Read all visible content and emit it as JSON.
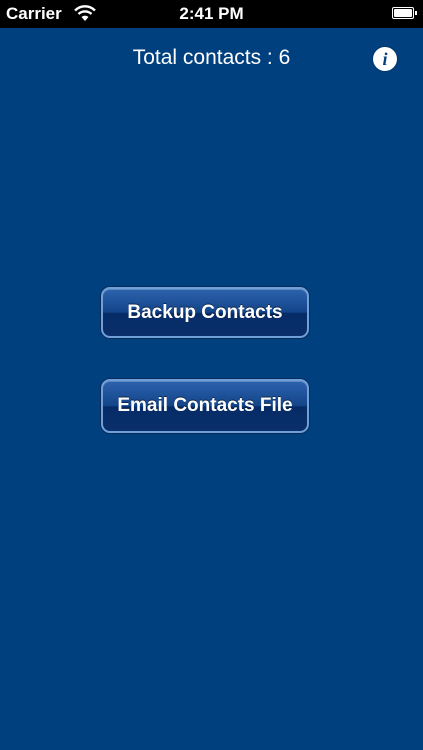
{
  "status_bar": {
    "carrier": "Carrier",
    "time": "2:41 PM",
    "wifi_icon": "wifi-icon",
    "battery_icon": "battery-icon",
    "battery_level": 1.0
  },
  "header": {
    "total_contacts": "Total contacts : 6",
    "info_icon": "info-icon",
    "info_glyph": "i"
  },
  "actions": {
    "backup_label": "Backup Contacts",
    "email_label": "Email Contacts File"
  },
  "colors": {
    "background": "#01407f",
    "button_border": "#6fa0d8",
    "status_bar": "#000000"
  }
}
